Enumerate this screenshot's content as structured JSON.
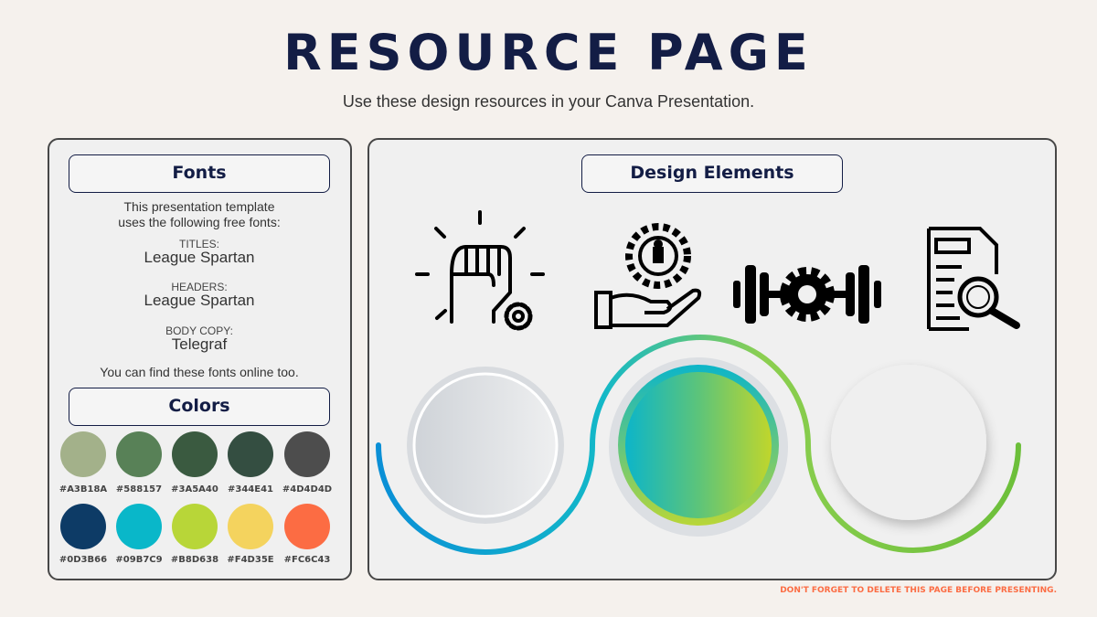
{
  "title": "RESOURCE PAGE",
  "subtitle": "Use these design resources in your Canva Presentation.",
  "fonts": {
    "heading": "Fonts",
    "intro1": "This presentation template",
    "intro2": "uses the following free fonts:",
    "titles_label": "TITLES:",
    "titles_font": "League Spartan",
    "headers_label": "HEADERS:",
    "headers_font": "League Spartan",
    "body_label": "BODY COPY:",
    "body_font": "Telegraf",
    "footer": "You can find these fonts online too."
  },
  "colors": {
    "heading": "Colors",
    "swatches": [
      "#A3B18A",
      "#588157",
      "#3A5A40",
      "#344E41",
      "#4D4D4D",
      "#0D3B66",
      "#09B7C9",
      "#B8D638",
      "#F4D35E",
      "#FC6C43"
    ]
  },
  "design": {
    "heading": "Design Elements",
    "icons": [
      "fist-gear-icon",
      "hand-gear-person-icon",
      "dumbbell-gear-icon",
      "document-search-icon"
    ]
  },
  "note": "DON'T FORGET TO DELETE THIS PAGE BEFORE PRESENTING."
}
